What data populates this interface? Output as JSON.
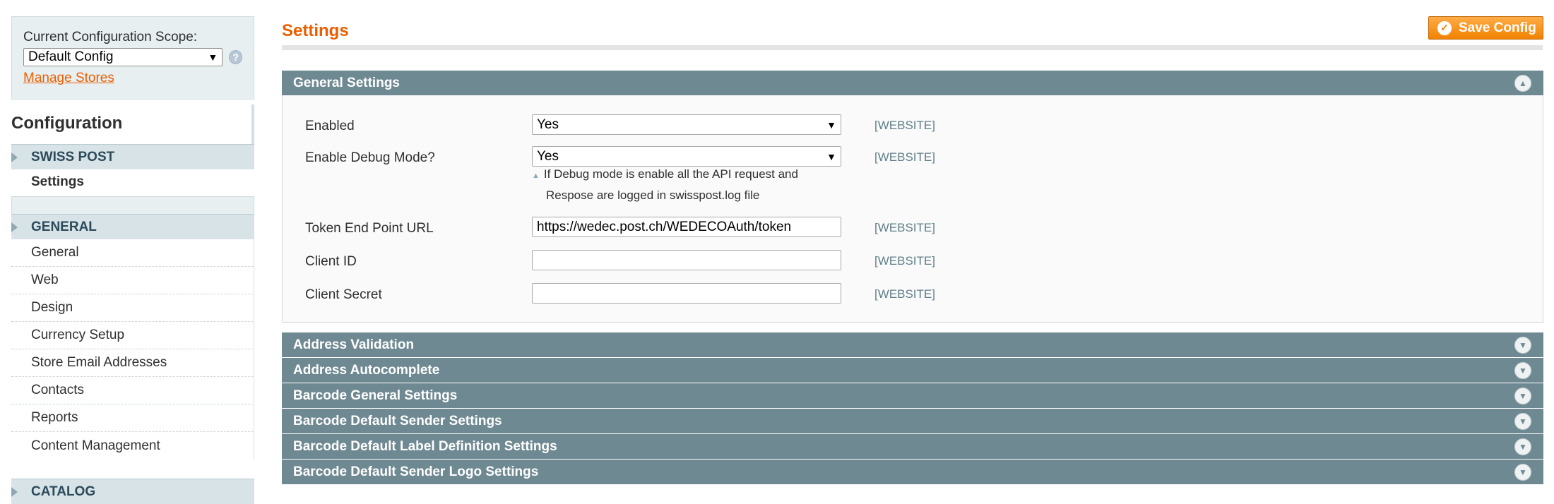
{
  "scope": {
    "label": "Current Configuration Scope:",
    "selected": "Default Config",
    "help_glyph": "?",
    "manage_stores": "Manage Stores"
  },
  "sidebar": {
    "heading": "Configuration",
    "tabs": [
      {
        "label": "SWISS POST",
        "items": [
          "Settings"
        ]
      },
      {
        "label": "GENERAL",
        "items": [
          "General",
          "Web",
          "Design",
          "Currency Setup",
          "Store Email Addresses",
          "Contacts",
          "Reports",
          "Content Management"
        ]
      },
      {
        "label": "CATALOG",
        "items": []
      }
    ]
  },
  "main": {
    "title": "Settings",
    "save_label": "Save Config",
    "general_section": {
      "title": "General Settings",
      "fields": [
        {
          "label": "Enabled",
          "type": "select",
          "value": "Yes",
          "scope": "[WEBSITE]"
        },
        {
          "label": "Enable Debug Mode?",
          "type": "select",
          "value": "Yes",
          "scope": "[WEBSITE]",
          "note_line1": "If Debug mode is enable all the API request and",
          "note_line2": "Respose are logged in swisspost.log file"
        },
        {
          "label": "Token End Point URL",
          "type": "text",
          "value": "https://wedec.post.ch/WEDECOAuth/token",
          "scope": "[WEBSITE]"
        },
        {
          "label": "Client ID",
          "type": "text",
          "value": "",
          "scope": "[WEBSITE]"
        },
        {
          "label": "Client Secret",
          "type": "text",
          "value": "",
          "scope": "[WEBSITE]"
        }
      ]
    },
    "collapsed_sections": [
      "Address Validation",
      "Address Autocomplete",
      "Barcode General Settings",
      "Barcode Default Sender Settings",
      "Barcode Default Label Definition Settings",
      "Barcode Default Sender Logo Settings"
    ]
  },
  "colors": {
    "accent_orange": "#eb5e00",
    "section_bar": "#6f8992",
    "sidebar_tab": "#d7e3e6"
  },
  "icons": {
    "save": "check-circle-icon",
    "section_open": "chevron-up-circle-icon",
    "section_closed": "chevron-down-circle-icon"
  }
}
